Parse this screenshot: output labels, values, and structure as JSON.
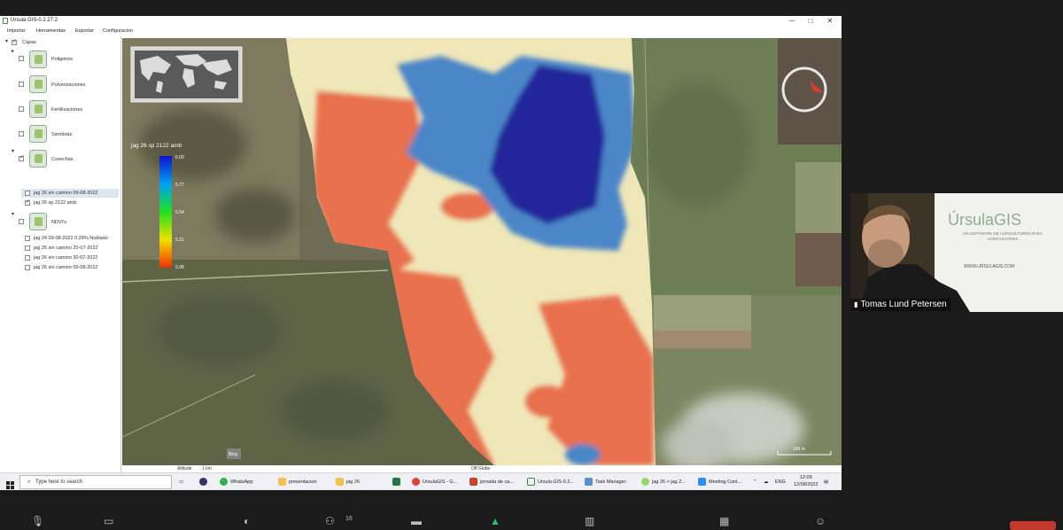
{
  "window": {
    "title": "Ursula GIS-0.2.27.2",
    "minimize": "─",
    "maximize": "□",
    "close": "✕"
  },
  "menu": [
    "Importar",
    "Herramientas",
    "Exportar",
    "Configuracion"
  ],
  "layers": {
    "root_label": "Capas",
    "groups": [
      {
        "label": "Poligonos"
      },
      {
        "label": "Pulverizaciones"
      },
      {
        "label": "Fertilizaciones"
      },
      {
        "label": "Siembras"
      },
      {
        "label": "Cosechas"
      }
    ],
    "cosechas_items": [
      "jag 26 sin camino 09-08-2022",
      "jag 26 sp 2122 amb"
    ],
    "ndvi_label": "NDVI's",
    "ndvi_items": [
      "jag 24 09-08-2022 0.28% Nublado",
      "jag 26 sin camino 20-07-2022",
      "jag 26 sin camino 30-07-2022",
      "jag 26 sin camino 09-08-2022"
    ]
  },
  "legend": {
    "title": "jag 26 sp 2122 amb",
    "ticks": [
      "6.00",
      "5.77",
      "5.54",
      "5.31",
      "5.08"
    ]
  },
  "map": {
    "scale_label": "100 m",
    "attribution": "Bing"
  },
  "status": {
    "altitude_label": "Altitude",
    "altitude_value": "1 km",
    "globe_label": "Off Globe"
  },
  "taskbar": {
    "search_placeholder": "Type here to search",
    "items": [
      "WhatsApp",
      "presentacion",
      "jag 26",
      "UrsulaGIS - G...",
      "jornada de ca...",
      "Ursula GIS-0.2...",
      "Task Manager",
      "jag 26 > jag 2...",
      "Meeting Cont..."
    ],
    "lang": "ENG",
    "time": "12:09",
    "date": "12/08/2022"
  },
  "video": {
    "participant_name": "Tomas Lund Petersen",
    "banner_brand": "ÚrsulaGIS",
    "banner_tagline": "UN SOFTWARE DE AGRICULTORES PARA AGRICULTORES",
    "banner_url": "WWW.URSULAGIS.COM"
  },
  "meeting": {
    "participant_count": "16"
  },
  "colors": {
    "high": "#22259a",
    "mid_high": "#4b86c8",
    "mid": "#efe7b8",
    "low": "#e8704e",
    "accent": "#7ec242"
  }
}
